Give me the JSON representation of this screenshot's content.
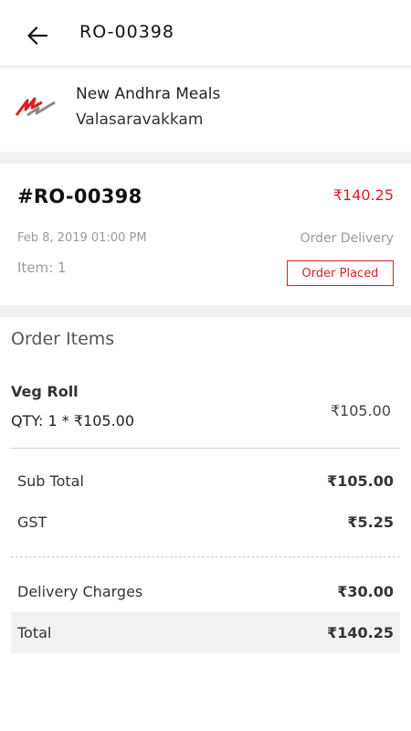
{
  "header": {
    "title": "RO-00398",
    "back_icon": "arrow-left-icon"
  },
  "restaurant": {
    "name": "New Andhra Meals",
    "area": "Valasaravakkam",
    "logo_colors": [
      "#d81f26",
      "#8a8a8a"
    ]
  },
  "order": {
    "id": "#RO-00398",
    "amount": "₹140.25",
    "date": "Feb 8, 2019 01:00 PM",
    "type": "Order Delivery",
    "item_count": "Item: 1",
    "status": "Order Placed"
  },
  "items_section": {
    "title": "Order Items",
    "items": [
      {
        "name": "Veg Roll",
        "qty_line": "QTY: 1 * ₹105.00",
        "price": "₹105.00"
      }
    ]
  },
  "summary": {
    "subtotal_label": "Sub Total",
    "subtotal_value": "₹105.00",
    "gst_label": "GST",
    "gst_value": "₹5.25",
    "delivery_label": "Delivery Charges",
    "delivery_value": "₹30.00",
    "total_label": "Total",
    "total_value": "₹140.25"
  },
  "colors": {
    "accent": "#d81f26",
    "muted": "#9a9a9a"
  }
}
